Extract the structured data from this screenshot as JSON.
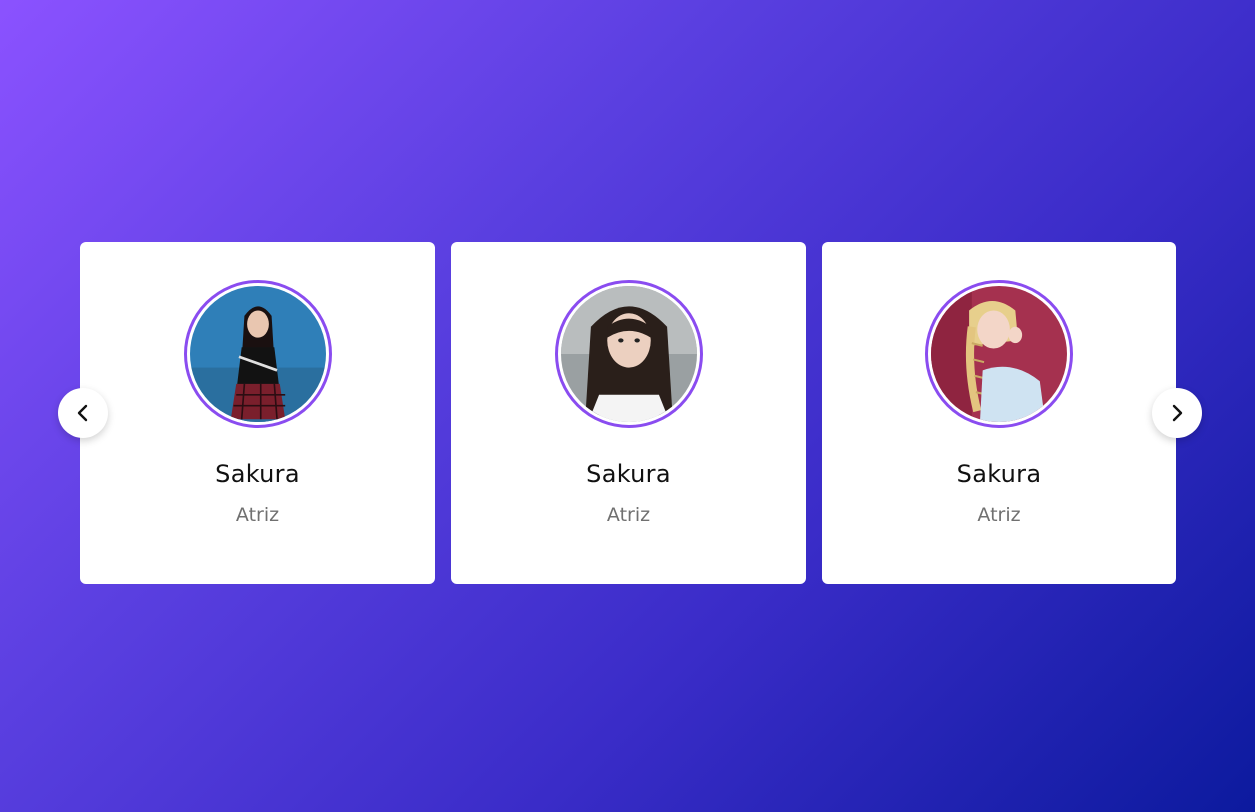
{
  "colors": {
    "accent": "#8a4cf0",
    "background_start": "#8b52ff",
    "background_end": "#0c1a9e",
    "card": "#ffffff",
    "name_text": "#111111",
    "role_text": "#707070"
  },
  "carousel": {
    "prev_icon": "chevron-left-icon",
    "next_icon": "chevron-right-icon",
    "cards": [
      {
        "name": "Sakura",
        "role": "Atriz",
        "avatar": "profile-photo"
      },
      {
        "name": "Sakura",
        "role": "Atriz",
        "avatar": "profile-photo"
      },
      {
        "name": "Sakura",
        "role": "Atriz",
        "avatar": "profile-photo"
      }
    ]
  }
}
